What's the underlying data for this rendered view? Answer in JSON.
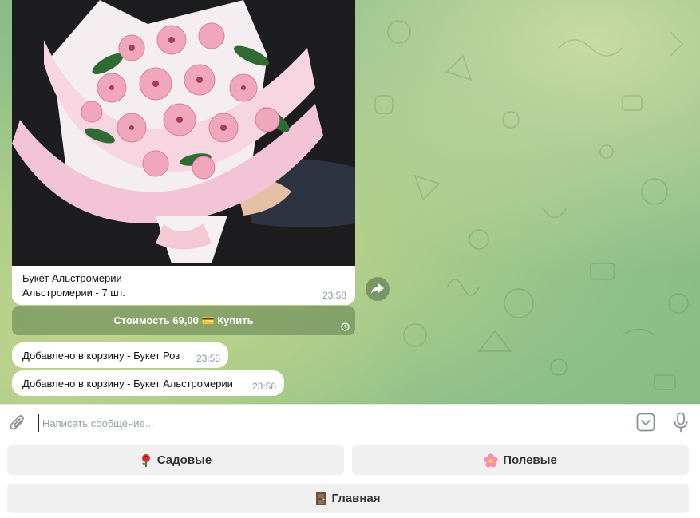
{
  "chat": {
    "photo_message": {
      "caption_title": "Букет Альстромерии",
      "caption_detail": "Альстромерии - 7 шт.",
      "time": "23:58"
    },
    "inline_button": {
      "label": "Стоимость 69,00 💳 Купить"
    },
    "messages": [
      {
        "text": "Добавлено в корзину - Букет Роз",
        "time": "23:58"
      },
      {
        "text": "Добавлено в корзину - Букет Альстромерии",
        "time": "23:58"
      }
    ]
  },
  "composer": {
    "placeholder": "Написать сообщение..."
  },
  "reply_keyboard": {
    "buttons": [
      {
        "label": "Садовые",
        "icon": "rose-icon"
      },
      {
        "label": "Полевые",
        "icon": "blossom-icon"
      },
      {
        "label": "Главная",
        "icon": "door-icon"
      }
    ]
  },
  "colors": {
    "wallpaper": "#9ec58a",
    "inline_button": "#6e8c5e",
    "time_text": "#8c9aa4"
  }
}
